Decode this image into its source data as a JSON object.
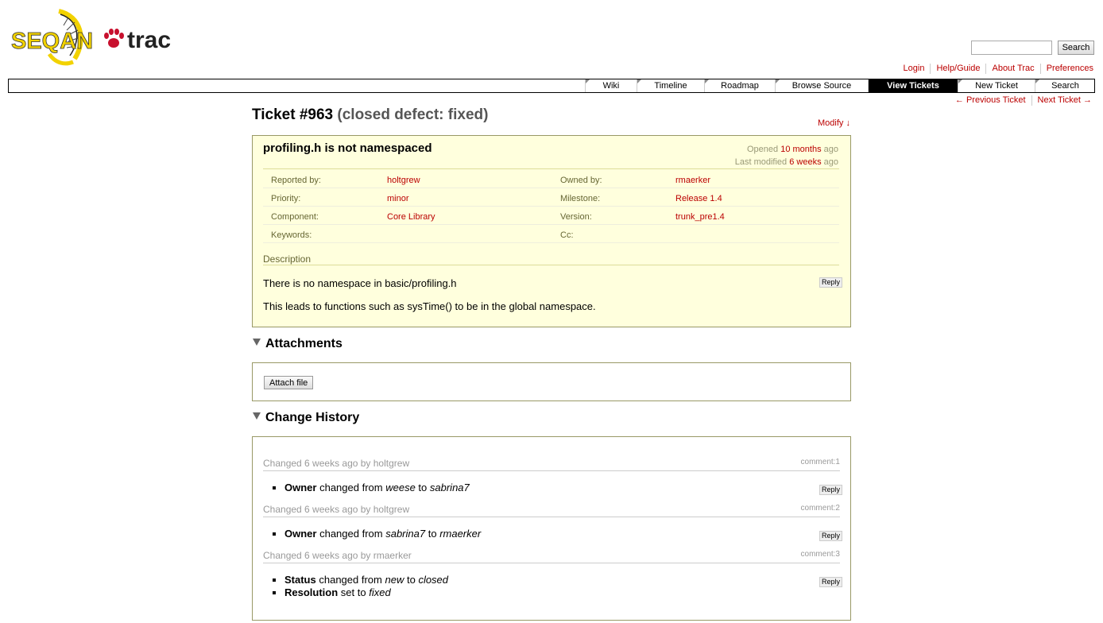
{
  "header": {
    "logo": {
      "left": "SEQAN",
      "right": "trac"
    },
    "search": {
      "value": "",
      "button": "Search"
    },
    "metanav": [
      "Login",
      "Help/Guide",
      "About Trac",
      "Preferences"
    ]
  },
  "mainnav": {
    "items": [
      "Wiki",
      "Timeline",
      "Roadmap",
      "Browse Source",
      "View Tickets",
      "New Ticket",
      "Search"
    ],
    "active": "View Tickets"
  },
  "ctxnav": {
    "prev": "← Previous Ticket",
    "next": "Next Ticket →"
  },
  "ticket": {
    "number": "Ticket #963",
    "status": "(closed defect: fixed)",
    "modify": "Modify ↓",
    "summary": "profiling.h is not namespaced",
    "opened_prefix": "Opened",
    "opened": "10 months",
    "opened_suffix": "ago",
    "modified_prefix": "Last modified",
    "modified": "6 weeks",
    "modified_suffix": "ago",
    "props": [
      {
        "label1": "Reported by:",
        "value1": "holtgrew",
        "label2": "Owned by:",
        "value2": "rmaerker"
      },
      {
        "label1": "Priority:",
        "value1": "minor",
        "label2": "Milestone:",
        "value2": "Release 1.4"
      },
      {
        "label1": "Component:",
        "value1": "Core Library",
        "label2": "Version:",
        "value2": "trunk_pre1.4"
      },
      {
        "label1": "Keywords:",
        "value1": "",
        "label2": "Cc:",
        "value2": ""
      }
    ],
    "description_label": "Description",
    "description": [
      "There is no namespace in basic/profiling.h",
      "This leads to functions such as sysTime() to be in the global namespace."
    ],
    "reply": "Reply"
  },
  "attachments": {
    "title": "Attachments",
    "button": "Attach file"
  },
  "history": {
    "title": "Change History",
    "changes": [
      {
        "head": "Changed 6 weeks ago by holtgrew",
        "comment": "comment:1",
        "items": [
          {
            "field": "Owner",
            "text1": "changed from",
            "from": "weese",
            "text2": "to",
            "to": "sabrina7"
          }
        ]
      },
      {
        "head": "Changed 6 weeks ago by holtgrew",
        "comment": "comment:2",
        "items": [
          {
            "field": "Owner",
            "text1": "changed from",
            "from": "sabrina7",
            "text2": "to",
            "to": "rmaerker"
          }
        ]
      },
      {
        "head": "Changed 6 weeks ago by rmaerker",
        "comment": "comment:3",
        "items": [
          {
            "field": "Status",
            "text1": "changed from",
            "from": "new",
            "text2": "to",
            "to": "closed"
          },
          {
            "field": "Resolution",
            "text1": "set to",
            "from": "fixed",
            "text2": "",
            "to": ""
          }
        ]
      }
    ]
  },
  "colors": {
    "link": "#bb0000",
    "ticket_bg": "#ffffdd",
    "ticket_border": "#999966",
    "active_nav_bg": "#000000",
    "logo_yellow": "#f2d200"
  }
}
